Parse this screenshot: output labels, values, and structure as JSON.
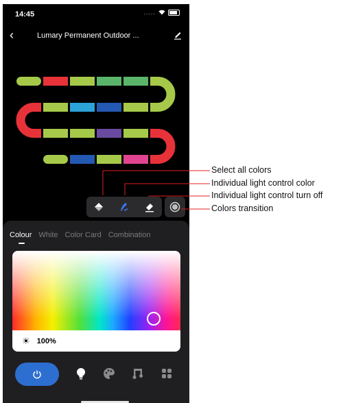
{
  "status_bar": {
    "time": "14:45",
    "signal": "....."
  },
  "header": {
    "title": "Lumary Permanent Outdoor ...",
    "back_icon": "chevron-left-icon",
    "edit_icon": "pencil-icon"
  },
  "strip_colors": {
    "lime": "#a7c94a",
    "red": "#e8323a",
    "green": "#5ab56a",
    "cyan": "#2ba3d9",
    "blue": "#2459b3",
    "purple": "#6a4aa0",
    "pink": "#e04490"
  },
  "toolbar": {
    "tools": [
      {
        "name": "fill-bucket-icon"
      },
      {
        "name": "brush-icon"
      },
      {
        "name": "eraser-icon"
      }
    ],
    "transition_icon": "colors-transition-icon"
  },
  "tabs": [
    {
      "label": "Colour",
      "active": true
    },
    {
      "label": "White",
      "active": false
    },
    {
      "label": "Color Card",
      "active": false
    },
    {
      "label": "Combination",
      "active": false
    }
  ],
  "picker": {
    "brightness": "100%"
  },
  "bottom_nav": {
    "items": [
      {
        "name": "power-icon",
        "active": true
      },
      {
        "name": "bulb-icon"
      },
      {
        "name": "palette-icon"
      },
      {
        "name": "music-icon"
      },
      {
        "name": "scenes-grid-icon"
      }
    ],
    "accent": "#2d6fd0"
  },
  "annotations": [
    {
      "label": "Select all colors"
    },
    {
      "label": "Individual light control color"
    },
    {
      "label": "Individual light control turn off"
    },
    {
      "label": "Colors transition"
    }
  ]
}
